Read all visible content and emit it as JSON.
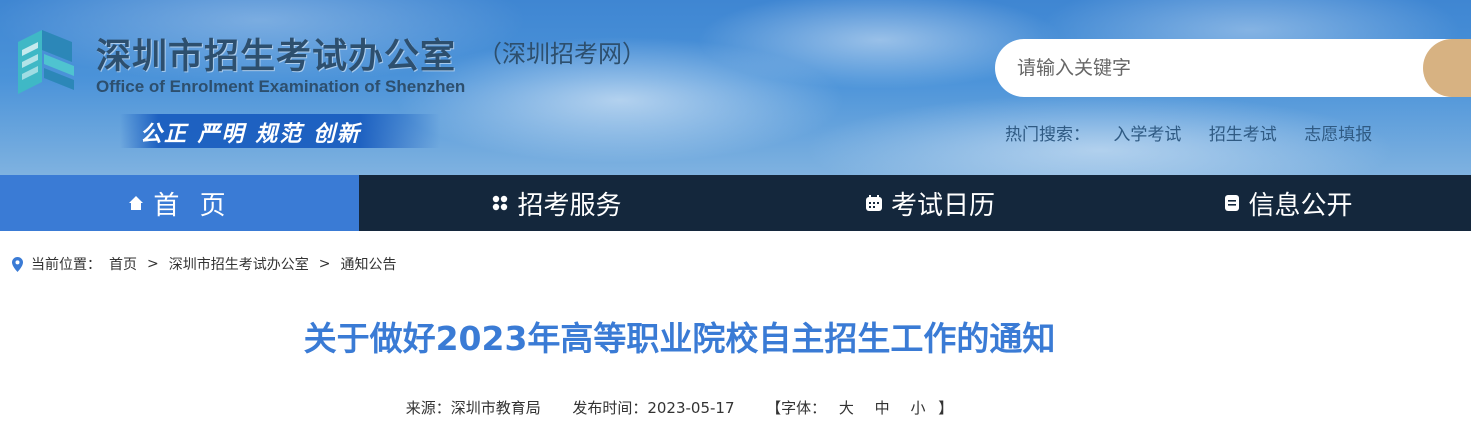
{
  "header": {
    "site_title": "深圳市招生考试办公室",
    "site_subtitle": "（深圳招考网）",
    "site_english": "Office of Enrolment Examination of Shenzhen",
    "slogan": "公正 严明 规范 创新",
    "colors": {
      "sky": "#4b93d9",
      "title": "#2d4f6e",
      "search_button": "#d7b282"
    }
  },
  "search": {
    "placeholder": "请输入关键字",
    "value": "",
    "button_icon": "search-icon"
  },
  "hot_search": {
    "label": "热门搜索：",
    "links": [
      "入学考试",
      "招生考试",
      "志愿填报"
    ]
  },
  "nav": {
    "colors": {
      "bar": "#14273c",
      "active": "#3a7bd5"
    },
    "items": [
      {
        "label": "首 页",
        "icon": "home-icon",
        "active": true
      },
      {
        "label": "招考服务",
        "icon": "grid-icon",
        "active": false
      },
      {
        "label": "考试日历",
        "icon": "calendar-icon",
        "active": false
      },
      {
        "label": "信息公开",
        "icon": "document-icon",
        "active": false
      }
    ]
  },
  "breadcrumb": {
    "icon": "location-pin-icon",
    "label": "当前位置：",
    "sep": ">",
    "items": [
      "首页",
      "深圳市招生考试办公室",
      "通知公告"
    ]
  },
  "article": {
    "title": "关于做好2023年高等职业院校自主招生工作的通知",
    "source": "来源：深圳市教育局",
    "publish_time": "发布时间：2023-05-17",
    "font_label_open": "【字体：",
    "font_sizes": [
      "大",
      "中",
      "小"
    ],
    "font_label_close": "】",
    "color": "#3a7bd5"
  }
}
